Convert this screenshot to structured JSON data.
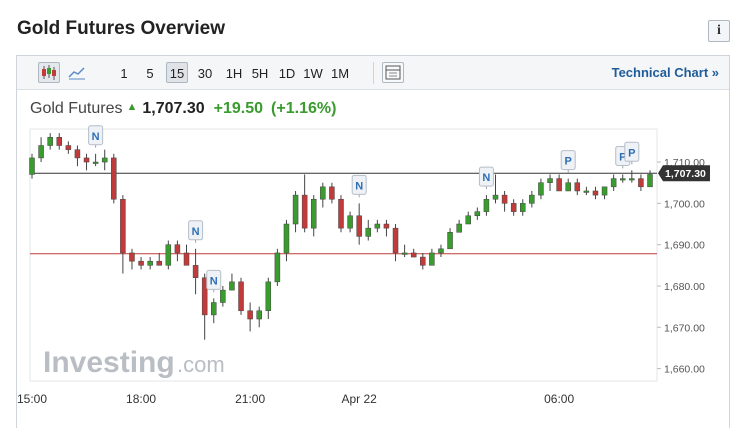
{
  "page": {
    "title": "Gold Futures Overview"
  },
  "toolbar": {
    "chart_types": [
      {
        "icon": "candlestick-chart-icon",
        "active": true
      },
      {
        "icon": "area-chart-icon",
        "active": false
      }
    ],
    "timeframes": [
      "1",
      "5",
      "15",
      "30",
      "1H",
      "5H",
      "1D",
      "1W",
      "1M"
    ],
    "active_timeframe": "15",
    "settings_icon": "chart-settings-icon",
    "technical_link": "Technical Chart »"
  },
  "quote": {
    "name": "Gold Futures",
    "direction_icon": "up-arrow-icon",
    "price": "1,707.30",
    "change": "+19.50",
    "change_pct": "(+1.16%)"
  },
  "watermark": {
    "brand": "Investing",
    "suffix": ".com"
  },
  "colors": {
    "up": "#3a9b2e",
    "down": "#c23b3b",
    "reference_line": "#333333",
    "prev_close_line": "#c23b3b",
    "price_label_bg": "#333333"
  },
  "chart_data": {
    "type": "candlestick",
    "title": "",
    "xlabel": "",
    "ylabel": "",
    "ylim": [
      1657,
      1718
    ],
    "y_ticks": [
      "1,660.00",
      "1,670.00",
      "1,680.00",
      "1,690.00",
      "1,700.00",
      "1,710.00"
    ],
    "y_tick_values": [
      1660,
      1670,
      1680,
      1690,
      1700,
      1710
    ],
    "x_ticks": [
      "15:00",
      "18:00",
      "21:00",
      "Apr 22",
      "06:00"
    ],
    "x_tick_index": [
      0,
      12,
      24,
      36,
      58
    ],
    "last_price": 1707.3,
    "last_price_label": "1,707.30",
    "prev_close": 1687.8,
    "event_markers": [
      {
        "label": "N",
        "index": 7
      },
      {
        "label": "N",
        "index": 18
      },
      {
        "label": "N",
        "index": 20
      },
      {
        "label": "N",
        "index": 36
      },
      {
        "label": "N",
        "index": 50
      },
      {
        "label": "P",
        "index": 59
      },
      {
        "label": "P",
        "index": 65
      },
      {
        "label": "P",
        "index": 66
      }
    ],
    "ohlc": [
      [
        1707,
        1712,
        1706,
        1711
      ],
      [
        1711,
        1716,
        1710,
        1714
      ],
      [
        1714,
        1717,
        1713,
        1716
      ],
      [
        1716,
        1717,
        1713,
        1714
      ],
      [
        1714,
        1715,
        1712,
        1713
      ],
      [
        1713,
        1714,
        1709,
        1711
      ],
      [
        1711,
        1712,
        1708,
        1710
      ],
      [
        1710,
        1712,
        1709,
        1710
      ],
      [
        1710,
        1713,
        1708,
        1711
      ],
      [
        1711,
        1712,
        1700,
        1701
      ],
      [
        1701,
        1702,
        1683,
        1688
      ],
      [
        1688,
        1689,
        1684,
        1686
      ],
      [
        1686,
        1687,
        1684,
        1685
      ],
      [
        1685,
        1687,
        1684,
        1686
      ],
      [
        1686,
        1688,
        1685,
        1685
      ],
      [
        1685,
        1691,
        1684,
        1690
      ],
      [
        1690,
        1691,
        1686,
        1688
      ],
      [
        1688,
        1690,
        1685,
        1685
      ],
      [
        1685,
        1689,
        1678,
        1682
      ],
      [
        1682,
        1683,
        1667,
        1673
      ],
      [
        1673,
        1677,
        1671,
        1676
      ],
      [
        1676,
        1680,
        1675,
        1679
      ],
      [
        1679,
        1683,
        1679,
        1681
      ],
      [
        1681,
        1682,
        1673,
        1674
      ],
      [
        1674,
        1676,
        1669,
        1672
      ],
      [
        1672,
        1675,
        1670,
        1674
      ],
      [
        1674,
        1682,
        1672,
        1681
      ],
      [
        1681,
        1689,
        1680,
        1688
      ],
      [
        1688,
        1696,
        1686,
        1695
      ],
      [
        1695,
        1703,
        1693,
        1702
      ],
      [
        1702,
        1707,
        1693,
        1694
      ],
      [
        1694,
        1702,
        1692,
        1701
      ],
      [
        1701,
        1705,
        1699,
        1704
      ],
      [
        1704,
        1705,
        1700,
        1701
      ],
      [
        1701,
        1702,
        1693,
        1694
      ],
      [
        1694,
        1698,
        1693,
        1697
      ],
      [
        1697,
        1700,
        1690,
        1692
      ],
      [
        1692,
        1696,
        1691,
        1694
      ],
      [
        1694,
        1696,
        1693,
        1695
      ],
      [
        1695,
        1696,
        1692,
        1694
      ],
      [
        1694,
        1695,
        1686,
        1688
      ],
      [
        1688,
        1690,
        1687,
        1688
      ],
      [
        1688,
        1689,
        1687,
        1687
      ],
      [
        1687,
        1688,
        1684,
        1685
      ],
      [
        1685,
        1689,
        1685,
        1688
      ],
      [
        1688,
        1690,
        1687,
        1689
      ],
      [
        1689,
        1694,
        1689,
        1693
      ],
      [
        1693,
        1696,
        1693,
        1695
      ],
      [
        1695,
        1698,
        1695,
        1697
      ],
      [
        1697,
        1699,
        1696,
        1698
      ],
      [
        1698,
        1702,
        1697,
        1701
      ],
      [
        1701,
        1707,
        1700,
        1702
      ],
      [
        1702,
        1703,
        1698,
        1700
      ],
      [
        1700,
        1701,
        1697,
        1698
      ],
      [
        1698,
        1701,
        1697,
        1700
      ],
      [
        1700,
        1703,
        1699,
        1702
      ],
      [
        1702,
        1706,
        1701,
        1705
      ],
      [
        1705,
        1707,
        1703,
        1706
      ],
      [
        1706,
        1707,
        1703,
        1703
      ],
      [
        1703,
        1706,
        1703,
        1705
      ],
      [
        1705,
        1706,
        1702,
        1703
      ],
      [
        1703,
        1704,
        1702,
        1703
      ],
      [
        1703,
        1704,
        1701,
        1702
      ],
      [
        1702,
        1704,
        1701,
        1704
      ],
      [
        1704,
        1707,
        1703,
        1706
      ],
      [
        1706,
        1707,
        1705,
        1706
      ],
      [
        1706,
        1708,
        1705,
        1706
      ],
      [
        1706,
        1707,
        1703,
        1704
      ],
      [
        1704,
        1708,
        1704,
        1707
      ]
    ]
  }
}
